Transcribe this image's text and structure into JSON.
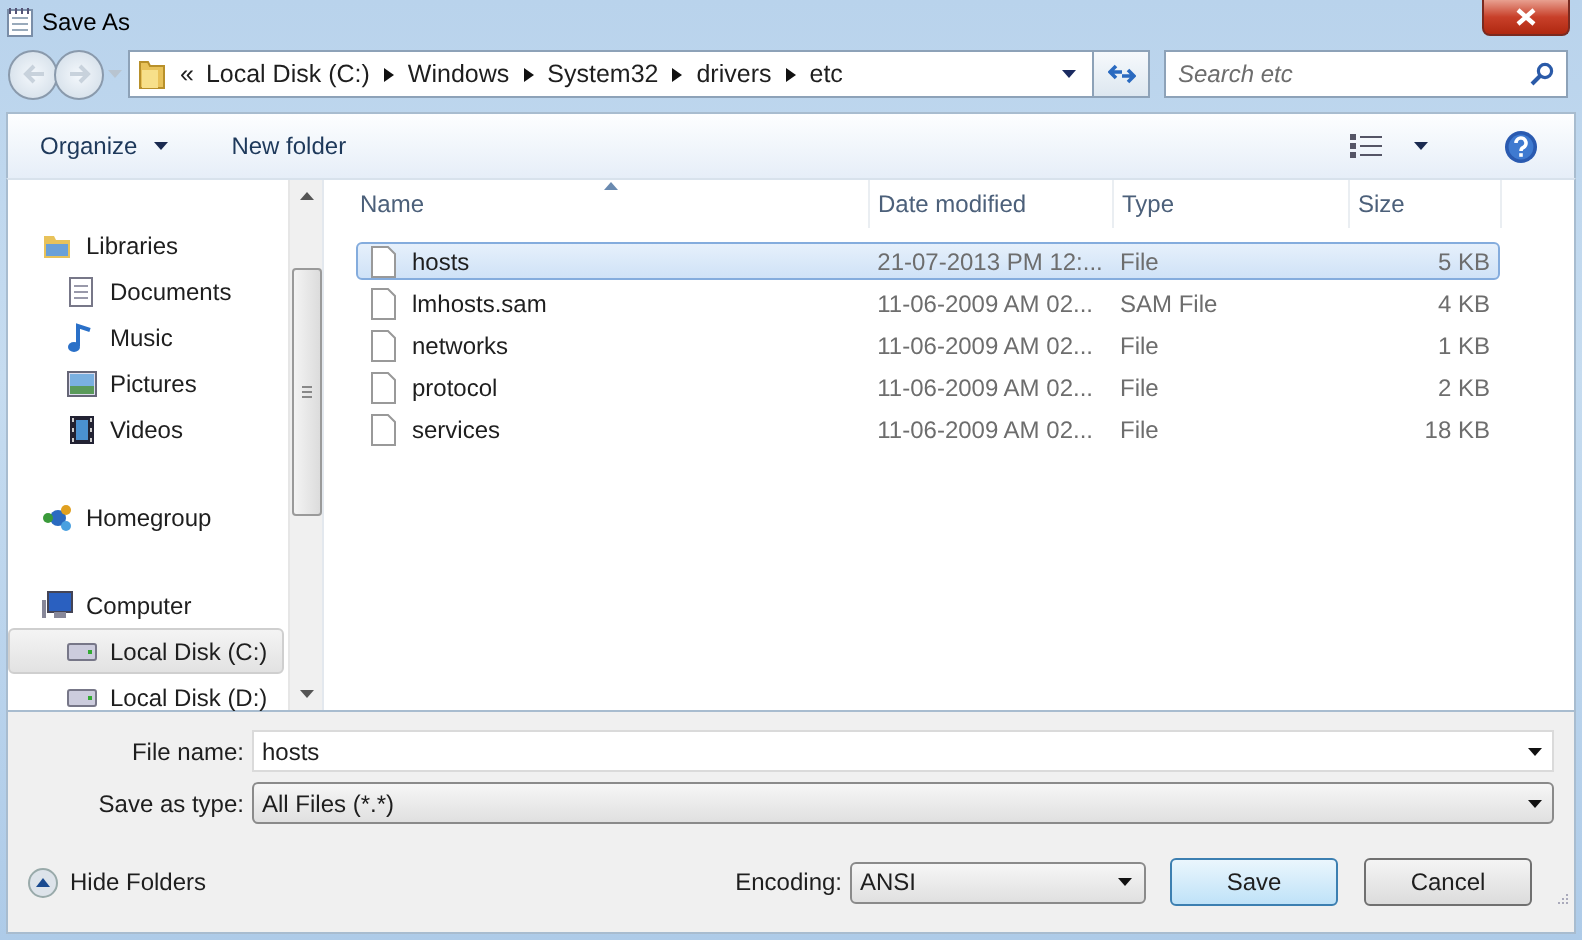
{
  "window": {
    "title": "Save As"
  },
  "address": {
    "overflow": "«",
    "segments": [
      "Local Disk (C:)",
      "Windows",
      "System32",
      "drivers",
      "etc"
    ]
  },
  "search": {
    "placeholder": "Search etc"
  },
  "toolbar": {
    "organize": "Organize",
    "new_folder": "New folder"
  },
  "sidebar": {
    "items": [
      {
        "label": "Libraries",
        "kind": "library",
        "selected": false,
        "children": [
          {
            "label": "Documents",
            "kind": "documents",
            "selected": false
          },
          {
            "label": "Music",
            "kind": "music",
            "selected": false
          },
          {
            "label": "Pictures",
            "kind": "pictures",
            "selected": false
          },
          {
            "label": "Videos",
            "kind": "videos",
            "selected": false
          }
        ]
      },
      {
        "label": "Homegroup",
        "kind": "homegroup",
        "selected": false
      },
      {
        "label": "Computer",
        "kind": "computer",
        "selected": false,
        "children": [
          {
            "label": "Local Disk (C:)",
            "kind": "drive",
            "selected": true
          },
          {
            "label": "Local Disk (D:)",
            "kind": "drive",
            "selected": false
          }
        ]
      }
    ]
  },
  "table": {
    "columns": [
      "Name",
      "Date modified",
      "Type",
      "Size"
    ],
    "rows": [
      {
        "cells": [
          "hosts",
          "21-07-2013 PM 12:...",
          "File",
          "5 KB"
        ],
        "selected": true
      },
      {
        "cells": [
          "lmhosts.sam",
          "11-06-2009 AM 02...",
          "SAM File",
          "4 KB"
        ],
        "selected": false
      },
      {
        "cells": [
          "networks",
          "11-06-2009 AM 02...",
          "File",
          "1 KB"
        ],
        "selected": false
      },
      {
        "cells": [
          "protocol",
          "11-06-2009 AM 02...",
          "File",
          "2 KB"
        ],
        "selected": false
      },
      {
        "cells": [
          "services",
          "11-06-2009 AM 02...",
          "File",
          "18 KB"
        ],
        "selected": false
      }
    ]
  },
  "form": {
    "file_name": {
      "label": "File name:",
      "value": "hosts"
    },
    "save_as_type": {
      "label": "Save as type:",
      "value": "All Files  (*.*)"
    }
  },
  "footer": {
    "hide_folders": "Hide Folders",
    "encoding": {
      "label": "Encoding:",
      "value": "ANSI"
    },
    "buttons": [
      {
        "label": "Save",
        "kind": "default"
      },
      {
        "label": "Cancel",
        "kind": "normal"
      }
    ]
  }
}
